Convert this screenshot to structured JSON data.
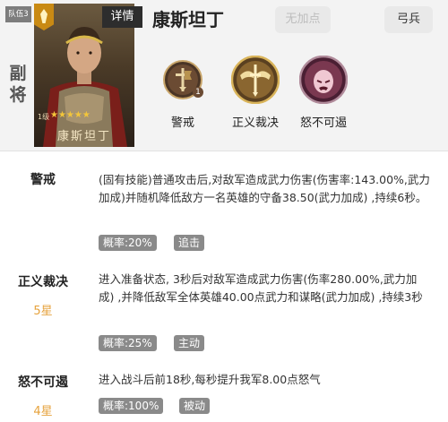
{
  "header": {
    "slot_label": "队伍3",
    "role_label": "副将",
    "detail_label": "详情",
    "hero_name": "康斯坦丁",
    "bonus_button": "无加点",
    "unit_type": "弓兵",
    "portrait": {
      "level": "1级",
      "stars": "★★★★★",
      "name": "康斯坦丁"
    }
  },
  "skill_icons": [
    {
      "label": "警戒",
      "icon": "sword-banner-icon",
      "badge": "1"
    },
    {
      "label": "正义裁决",
      "icon": "winged-sword-icon"
    },
    {
      "label": "怒不可遏",
      "icon": "raging-warrior-icon"
    }
  ],
  "skills": [
    {
      "name": "警戒",
      "stars": "",
      "description": "(固有技能)普通攻击后,对敌军造成武力伤害(伤害率:143.00%,武力加成)并随机降低敌方一名英雄的守备38.50(武力加成) ,持续6秒。",
      "rate": "概率:20%",
      "type": "追击"
    },
    {
      "name": "正义裁决",
      "stars": "5星",
      "description": "进入准备状态, 3秒后对敌军造成武力伤害(伤率280.00%,武力加成) ,并降低敌军全体英雄40.00点武力和谋略(武力加成) ,持续3秒",
      "rate": "概率:25%",
      "type": "主动"
    },
    {
      "name": "怒不可遏",
      "stars": "4星",
      "description": "进入战斗后前18秒,每秒提升我军8.00点怒气",
      "rate": "概率:100%",
      "type": "被动"
    }
  ],
  "colors": {
    "star": "#e6a23c",
    "tag": "#8a8a8a",
    "header_bg": "#f3f3f3"
  }
}
